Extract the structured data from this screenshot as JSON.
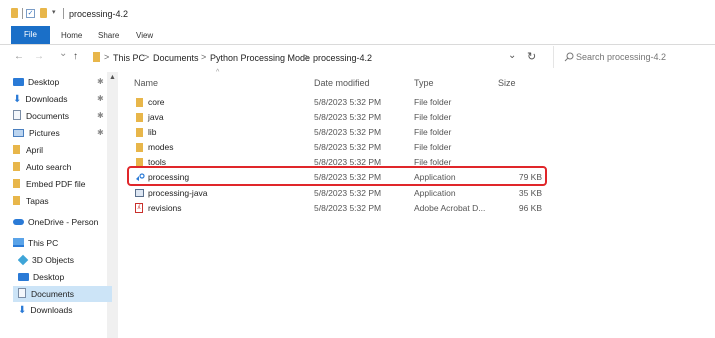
{
  "titlebar": {
    "title": "processing-4.2"
  },
  "ribbon": {
    "file": "File",
    "home": "Home",
    "share": "Share",
    "view": "View"
  },
  "nav": {
    "back": "←",
    "forward": "→",
    "recent": "⌄",
    "up": "↑",
    "refresh": "↻",
    "dropdown": "⌄"
  },
  "address": {
    "crumbs": [
      "This PC",
      "Documents",
      "Python Processing Mode",
      "processing-4.2"
    ],
    "separator": ">"
  },
  "search": {
    "placeholder": "Search processing-4.2"
  },
  "sidebar": {
    "items": [
      {
        "label": "Desktop",
        "icon": "desktop-icon",
        "pinned": true
      },
      {
        "label": "Downloads",
        "icon": "download-icon",
        "pinned": true
      },
      {
        "label": "Documents",
        "icon": "documents-icon",
        "pinned": true
      },
      {
        "label": "Pictures",
        "icon": "pictures-icon",
        "pinned": true
      },
      {
        "label": "April",
        "icon": "folder-icon",
        "pinned": false
      },
      {
        "label": "Auto search",
        "icon": "folder-icon",
        "pinned": false
      },
      {
        "label": "Embed PDF file",
        "icon": "folder-icon",
        "pinned": false
      },
      {
        "label": "Tapas",
        "icon": "folder-icon",
        "pinned": false
      },
      {
        "label": "OneDrive - Person",
        "icon": "onedrive-icon",
        "pinned": false
      },
      {
        "label": "This PC",
        "icon": "this-pc-icon",
        "pinned": false
      },
      {
        "label": "3D Objects",
        "icon": "3d-objects-icon",
        "pinned": false
      },
      {
        "label": "Desktop",
        "icon": "desktop-icon",
        "pinned": false
      },
      {
        "label": "Documents",
        "icon": "documents-icon",
        "pinned": false,
        "selected": true
      },
      {
        "label": "Downloads",
        "icon": "download-icon",
        "pinned": false
      }
    ],
    "pin_glyph": "📌"
  },
  "columns": {
    "name": "Name",
    "date": "Date modified",
    "type": "Type",
    "size": "Size"
  },
  "files": [
    {
      "name": "core",
      "date": "5/8/2023 5:32 PM",
      "type": "File folder",
      "size": "",
      "icon": "folder-icon"
    },
    {
      "name": "java",
      "date": "5/8/2023 5:32 PM",
      "type": "File folder",
      "size": "",
      "icon": "folder-icon"
    },
    {
      "name": "lib",
      "date": "5/8/2023 5:32 PM",
      "type": "File folder",
      "size": "",
      "icon": "folder-icon"
    },
    {
      "name": "modes",
      "date": "5/8/2023 5:32 PM",
      "type": "File folder",
      "size": "",
      "icon": "folder-icon"
    },
    {
      "name": "tools",
      "date": "5/8/2023 5:32 PM",
      "type": "File folder",
      "size": "",
      "icon": "folder-icon"
    },
    {
      "name": "processing",
      "date": "5/8/2023 5:32 PM",
      "type": "Application",
      "size": "79 KB",
      "icon": "processing-app-icon",
      "highlighted": true
    },
    {
      "name": "processing-java",
      "date": "5/8/2023 5:32 PM",
      "type": "Application",
      "size": "35 KB",
      "icon": "console-app-icon"
    },
    {
      "name": "revisions",
      "date": "5/8/2023 5:32 PM",
      "type": "Adobe Acrobat D...",
      "size": "96 KB",
      "icon": "pdf-icon"
    }
  ],
  "colors": {
    "accent": "#1a6fc8",
    "highlight": "#e0262a",
    "folder": "#e8b64a",
    "selection": "#cce4f7"
  }
}
